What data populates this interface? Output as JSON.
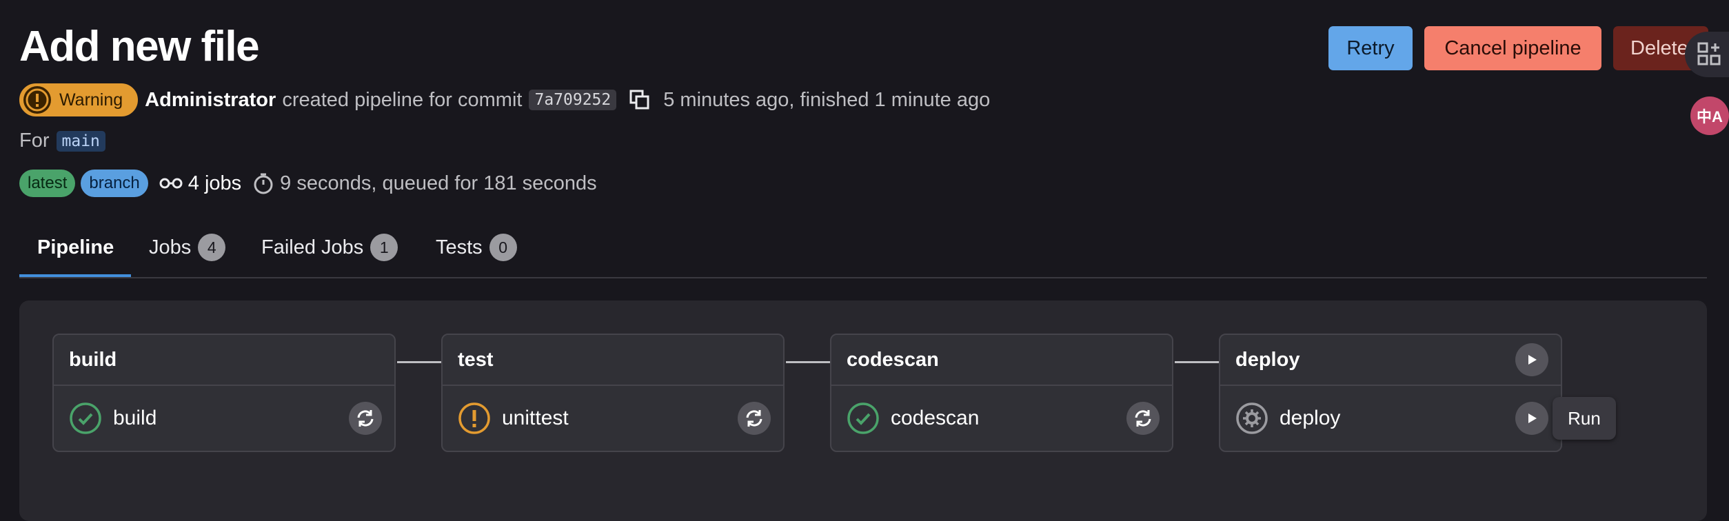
{
  "header": {
    "title": "Add new file",
    "actions": {
      "retry": "Retry",
      "cancel": "Cancel pipeline",
      "delete": "Delete"
    }
  },
  "meta": {
    "status_label": "Warning",
    "author": "Administrator",
    "created_text": "created pipeline for commit",
    "commit_sha": "7a709252",
    "time_text": "5 minutes ago, finished 1 minute ago",
    "for_label": "For",
    "ref": "main",
    "badges": [
      "latest",
      "branch"
    ],
    "jobs_count": "4 jobs",
    "duration_text": "9 seconds, queued for 181 seconds"
  },
  "side_widgets": {
    "translate_glyph": "中A"
  },
  "tabs": [
    {
      "label": "Pipeline",
      "count": ""
    },
    {
      "label": "Jobs",
      "count": "4"
    },
    {
      "label": "Failed Jobs",
      "count": "1"
    },
    {
      "label": "Tests",
      "count": "0"
    }
  ],
  "stages": [
    {
      "name": "build",
      "job": "build",
      "status": "success"
    },
    {
      "name": "test",
      "job": "unittest",
      "status": "warning"
    },
    {
      "name": "codescan",
      "job": "codescan",
      "status": "success"
    },
    {
      "name": "deploy",
      "job": "deploy",
      "status": "manual"
    }
  ],
  "tooltip": "Run",
  "colors": {
    "background": "#18171d",
    "retry": "#63a6e9",
    "cancel": "#f57f6c",
    "delete": "#6b231d",
    "warning": "#e39b30",
    "success": "#4aa36a",
    "tab_active": "#428fdc"
  }
}
